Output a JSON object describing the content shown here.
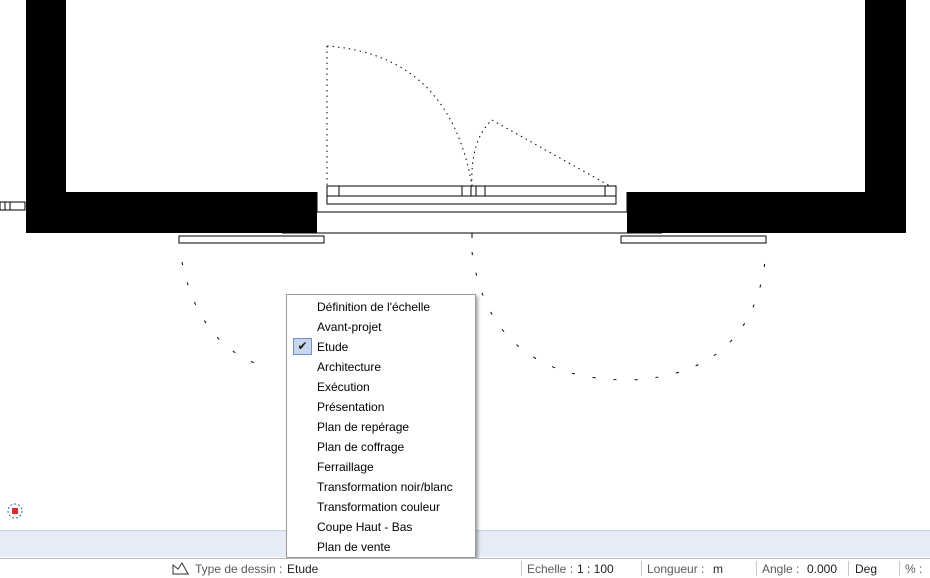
{
  "context_menu": {
    "items": [
      {
        "label": "Définition de l'échelle",
        "checked": false
      },
      {
        "label": "Avant-projet",
        "checked": false
      },
      {
        "label": "Etude",
        "checked": true
      },
      {
        "label": "Architecture",
        "checked": false
      },
      {
        "label": "Exécution",
        "checked": false
      },
      {
        "label": "Présentation",
        "checked": false
      },
      {
        "label": "Plan de repérage",
        "checked": false
      },
      {
        "label": "Plan de coffrage",
        "checked": false
      },
      {
        "label": "Ferraillage",
        "checked": false
      },
      {
        "label": "Transformation noir/blanc",
        "checked": false
      },
      {
        "label": "Transformation couleur",
        "checked": false
      },
      {
        "label": "Coupe Haut - Bas",
        "checked": false
      },
      {
        "label": "Plan de vente",
        "checked": false
      }
    ],
    "check_mark": "✔"
  },
  "status_bar": {
    "drawing_type_label": "Type de dessin :",
    "drawing_type_value": "Etude",
    "scale_label": "Echelle :",
    "scale_value": "1 : 100",
    "length_label": "Longueur :",
    "length_value": "m",
    "angle_label": "Angle :",
    "angle_value": "0.000",
    "angle_unit": "Deg",
    "percent_label": "% :"
  },
  "colors": {
    "wall": "#000000",
    "menu_check_bg": "#c7d6ec",
    "band": "#e6ecf6",
    "snap_icon": "#d03030"
  },
  "icons": {
    "drawing_type": "drawing-type-icon",
    "snap": "snap-target-icon"
  }
}
